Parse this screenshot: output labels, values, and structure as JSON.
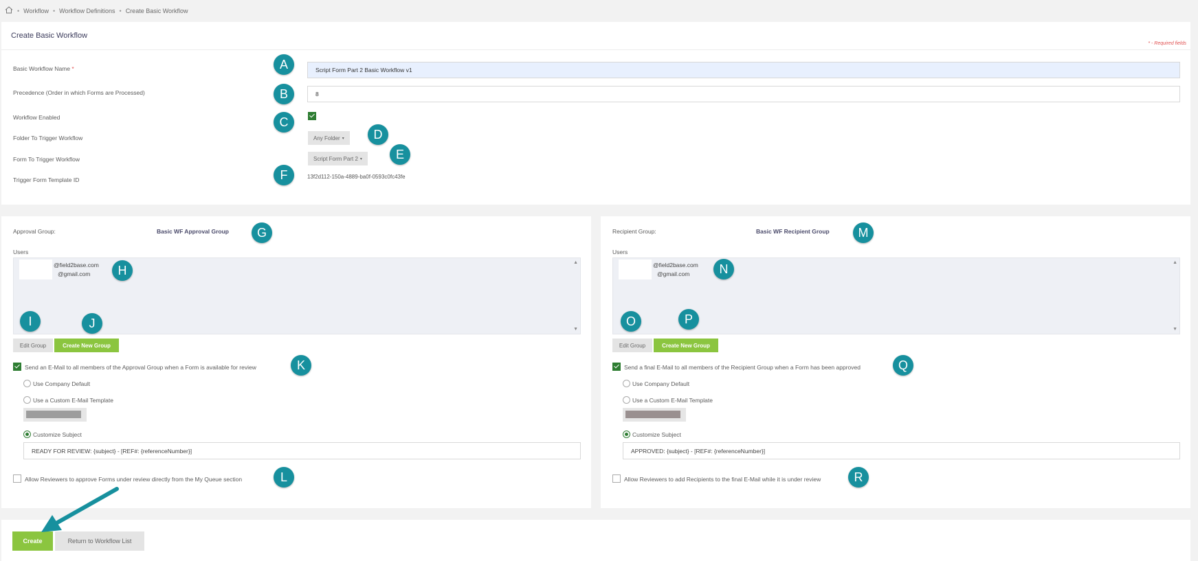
{
  "breadcrumb": {
    "home_icon": "home-icon",
    "items": [
      "Workflow",
      "Workflow Definitions",
      "Create Basic Workflow"
    ],
    "sep": "•"
  },
  "header": {
    "title": "Create Basic Workflow",
    "required_note": "* - Required fields"
  },
  "form": {
    "name_label": "Basic Workflow Name",
    "name_required": "*",
    "name_value": "Script Form Part 2 Basic Workflow v1",
    "precedence_label": "Precedence (Order in which Forms are Processed)",
    "precedence_value": "8",
    "enabled_label": "Workflow Enabled",
    "enabled": true,
    "folder_label": "Folder To Trigger Workflow",
    "folder_value": "Any Folder",
    "form_label": "Form To Trigger Workflow",
    "form_value": "Script Form Part 2",
    "template_label": "Trigger Form Template ID",
    "template_value": "13f2d112-150a-4889-ba0f-0593c0fc43fe"
  },
  "approval": {
    "group_label": "Approval Group:",
    "group_name": "Basic WF Approval Group",
    "users_label": "Users",
    "users": [
      "@field2base.com",
      "@gmail.com"
    ],
    "edit_button": "Edit Group",
    "create_button": "Create New Group",
    "email_check_label": "Send an E-Mail to all members of the Approval Group when a Form is available for review",
    "email_checked": true,
    "radio_default": "Use Company Default",
    "radio_custom": "Use a Custom E-Mail Template",
    "radio_subject": "Customize Subject",
    "selected_radio": "subject",
    "subject_value": "READY FOR REVIEW: {subject} - [REF#: {referenceNumber}]",
    "allow_label": "Allow Reviewers to approve Forms under review directly from the My Queue section",
    "allow_checked": false
  },
  "recipient": {
    "group_label": "Recipient Group:",
    "group_name": "Basic WF Recipient Group",
    "users_label": "Users",
    "users": [
      "@field2base.com",
      "@gmail.com"
    ],
    "edit_button": "Edit Group",
    "create_button": "Create New Group",
    "email_check_label": "Send a final E-Mail to all members of the Recipient Group when a Form has been approved",
    "email_checked": true,
    "radio_default": "Use Company Default",
    "radio_custom": "Use a Custom E-Mail Template",
    "radio_subject": "Customize Subject",
    "selected_radio": "subject",
    "subject_value": "APPROVED: {subject} - [REF#: {referenceNumber}]",
    "allow_label": "Allow Reviewers to add Recipients to the final E-Mail while it is under review",
    "allow_checked": false
  },
  "footer": {
    "create_button": "Create",
    "return_button": "Return to Workflow List"
  },
  "markers": [
    "A",
    "B",
    "C",
    "D",
    "E",
    "F",
    "G",
    "H",
    "I",
    "J",
    "K",
    "L",
    "M",
    "N",
    "O",
    "P",
    "Q",
    "R"
  ],
  "colors": {
    "green": "#8bc53f",
    "marker": "#17909e",
    "check": "#2e7d32",
    "input_highlight": "#e8f0fe"
  }
}
